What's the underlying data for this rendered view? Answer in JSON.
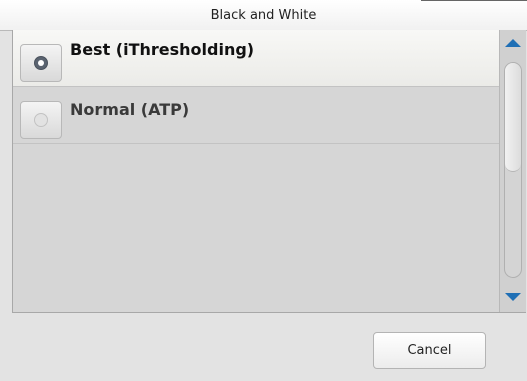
{
  "dialog": {
    "title": "Black and White"
  },
  "options": [
    {
      "label": "Best (iThresholding)",
      "selected": true
    },
    {
      "label": "Normal (ATP)",
      "selected": false
    }
  ],
  "scrollbar": {
    "up_icon": "triangle-up",
    "down_icon": "triangle-down",
    "arrow_color": "#1f6fb5"
  },
  "buttons": {
    "cancel": "Cancel"
  }
}
